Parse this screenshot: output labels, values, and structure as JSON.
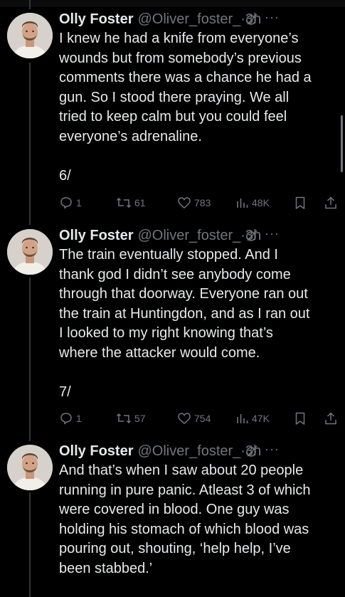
{
  "tweets": [
    {
      "name": "Olly Foster",
      "handle": "@Oliver_foster_",
      "time": "·3h",
      "text": "I knew he had a knife from everyone’s\nwounds but from somebody’s previous\ncomments there was a chance he had a\ngun. So I stood there praying. We all\ntried to keep calm but you could feel\neveryone’s adrenaline.\n\n6/",
      "replies": "1",
      "reposts": "61",
      "likes": "783",
      "views": "48K"
    },
    {
      "name": "Olly Foster",
      "handle": "@Oliver_foster_",
      "time": "·3h",
      "text": "The train eventually stopped. And I\nthank god I didn’t see anybody come\nthrough that doorway. Everyone ran out\nthe train at Huntingdon, and as I ran out\nI looked to my right knowing that’s\nwhere the attacker would come.\n\n7/",
      "replies": "1",
      "reposts": "57",
      "likes": "754",
      "views": "47K"
    },
    {
      "name": "Olly Foster",
      "handle": "@Oliver_foster_",
      "time": "·3h",
      "text": "And that’s when I saw about 20 people\nrunning in pure panic. Atleast 3 of which\nwere covered in blood. One guy was\nholding his stomach of which blood was\npouring out, shouting, ‘help help, I’ve\nbeen stabbed.’"
    }
  ],
  "icons": {
    "more": "more-icon",
    "grok": "grok-icon",
    "reply": "reply-icon",
    "repost": "repost-icon",
    "like": "like-icon",
    "views": "views-icon",
    "bookmark": "bookmark-icon",
    "share": "share-icon"
  },
  "colors": {
    "background": "#000000",
    "text": "#e7e9ea",
    "secondary": "#71767b",
    "thread_line": "#333639"
  }
}
